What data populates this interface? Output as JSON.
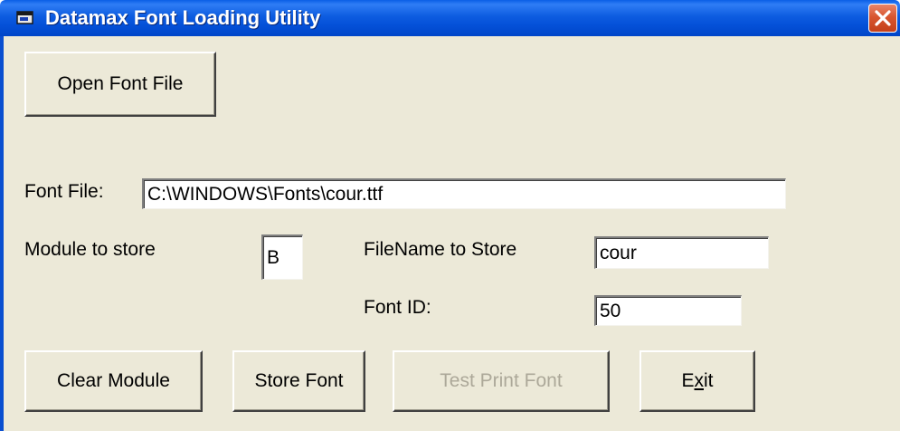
{
  "window": {
    "title": "Datamax Font Loading Utility",
    "close_icon": "close-icon",
    "app_icon": "app-icon"
  },
  "buttons": {
    "open_font_file": "Open Font File",
    "clear_module": "Clear Module",
    "store_font": "Store Font",
    "test_print_font": "Test Print Font",
    "exit_prefix": "E",
    "exit_mnemonic": "x",
    "exit_suffix": "it"
  },
  "labels": {
    "font_file": "Font File:",
    "module_to_store": "Module to store",
    "filename_to_store": "FileName to Store",
    "font_id": "Font ID:"
  },
  "fields": {
    "font_file_value": "C:\\WINDOWS\\Fonts\\cour.ttf",
    "module_value": "B",
    "filename_value": "cour",
    "font_id_value": "50"
  },
  "colors": {
    "titlebar": "#0450d8",
    "face": "#ece9d8",
    "disabled_text": "#aca899",
    "close": "#d8562f"
  }
}
